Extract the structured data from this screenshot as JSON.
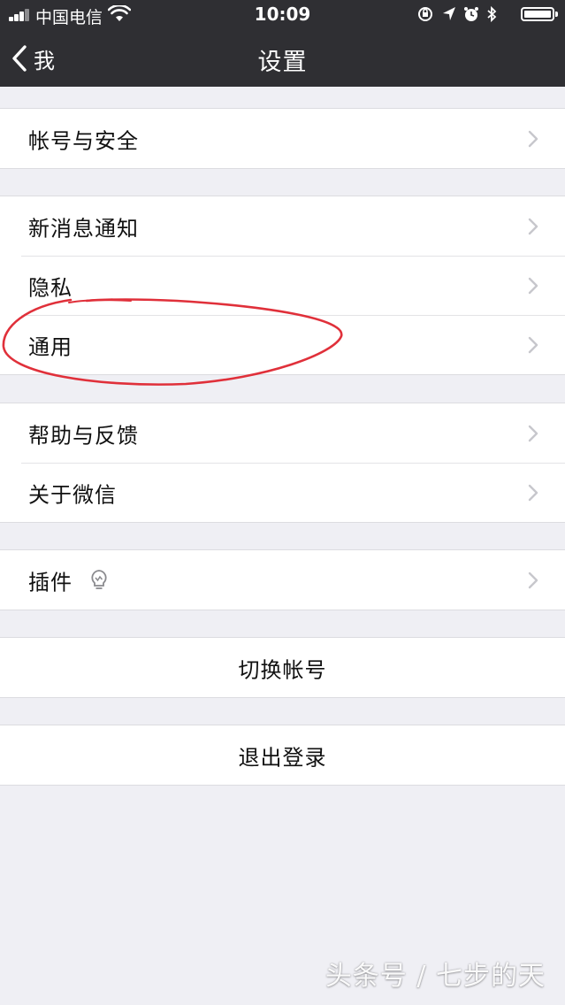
{
  "status_bar": {
    "carrier": "中国电信",
    "time": "10:09"
  },
  "nav": {
    "back_label": "我",
    "title": "设置"
  },
  "groups": {
    "account": {
      "items": [
        {
          "label": "帐号与安全"
        }
      ]
    },
    "general": {
      "items": [
        {
          "label": "新消息通知"
        },
        {
          "label": "隐私"
        },
        {
          "label": "通用"
        }
      ]
    },
    "help": {
      "items": [
        {
          "label": "帮助与反馈"
        },
        {
          "label": "关于微信"
        }
      ]
    },
    "plugins": {
      "items": [
        {
          "label": "插件",
          "icon": "lightbulb-icon"
        }
      ]
    }
  },
  "actions": {
    "switch_account": "切换帐号",
    "logout": "退出登录"
  },
  "watermark": "头条号 / 七步的天",
  "colors": {
    "nav_bg": "#2f2f33",
    "page_bg": "#efeff4",
    "annotation": "#e0303a",
    "chevron": "#c7c7cc"
  }
}
